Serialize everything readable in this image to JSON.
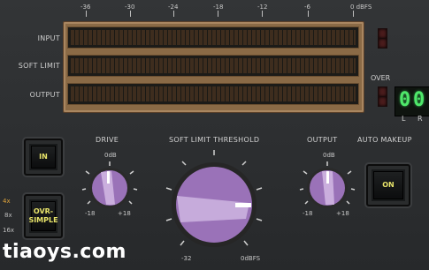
{
  "scale": {
    "labels": [
      "-36",
      "-30",
      "-24",
      "-18",
      "-12",
      "-6",
      "0 dBFS"
    ]
  },
  "meters": [
    {
      "label": "INPUT"
    },
    {
      "label": "SOFT LIMIT"
    },
    {
      "label": "OUTPUT"
    }
  ],
  "over": {
    "label": "OVER",
    "digits": [
      "0",
      "0"
    ],
    "l": "L",
    "r": "R"
  },
  "in_button": {
    "label": "IN"
  },
  "oversample_button": {
    "line1": "OVR-",
    "line2": "SIMPLE"
  },
  "oversample_options": [
    "4x",
    "8x",
    "16x"
  ],
  "drive": {
    "title": "DRIVE",
    "top": "0dB",
    "left": "-18",
    "right": "+18"
  },
  "threshold": {
    "title": "SOFT LIMIT THRESHOLD",
    "left": "-32",
    "right": "0dBFS"
  },
  "output": {
    "title": "OUTPUT",
    "top": "0dB",
    "left": "-18",
    "right": "+18"
  },
  "auto_makeup": {
    "title": "AUTO MAKEUP",
    "button": "ON"
  },
  "watermark": "tiaoys.com",
  "colors": {
    "digit": "#4fe86a",
    "knob": "#b38ad0",
    "button_text": "#e8e46a"
  }
}
